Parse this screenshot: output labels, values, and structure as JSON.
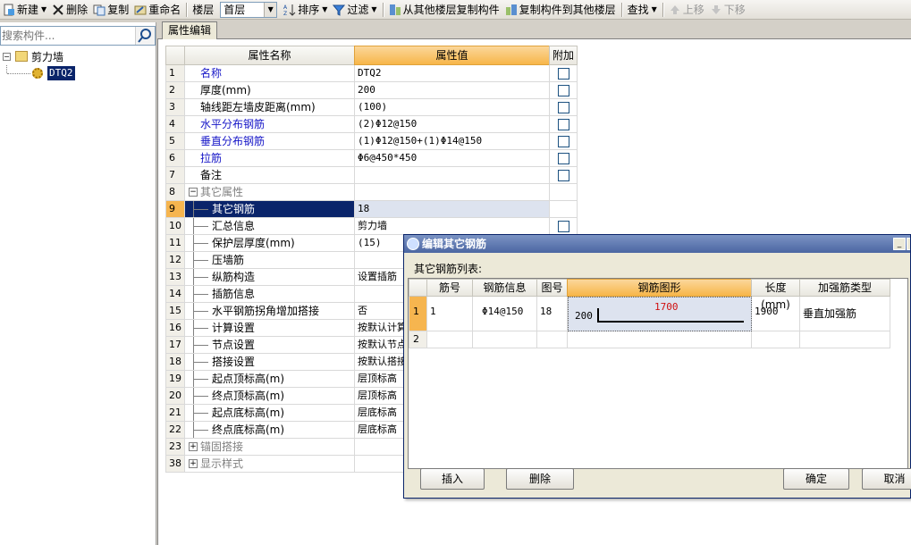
{
  "toolbar": {
    "new_label": "新建",
    "delete_label": "删除",
    "copy_label": "复制",
    "rename_label": "重命名",
    "floor_label": "楼层",
    "floor_value": "首层",
    "sort_label": "排序",
    "filter_label": "过滤",
    "copy_from_label": "从其他楼层复制构件",
    "copy_to_label": "复制构件到其他楼层",
    "find_label": "查找",
    "up_label": "上移",
    "down_label": "下移"
  },
  "search": {
    "placeholder": "搜索构件..."
  },
  "tree": {
    "root_label": "剪力墙",
    "child_label": "DTQ2"
  },
  "tab_label": "属性编辑",
  "grid": {
    "headers": {
      "name": "属性名称",
      "value": "属性值",
      "extra": "附加"
    },
    "rows": [
      {
        "num": "1",
        "name": "名称",
        "value": "DTQ2"
      },
      {
        "num": "2",
        "name": "厚度(mm)",
        "value": "200"
      },
      {
        "num": "3",
        "name": "轴线距左墙皮距离(mm)",
        "value": "(100)"
      },
      {
        "num": "4",
        "name": "水平分布钢筋",
        "value": "(2)Φ12@150"
      },
      {
        "num": "5",
        "name": "垂直分布钢筋",
        "value": "(1)Φ12@150+(1)Φ14@150"
      },
      {
        "num": "6",
        "name": "拉筋",
        "value": "Φ6@450*450"
      },
      {
        "num": "7",
        "name": "备注",
        "value": ""
      },
      {
        "num": "8",
        "name": "其它属性",
        "value": ""
      },
      {
        "num": "9",
        "name": "其它钢筋",
        "value": "18"
      },
      {
        "num": "10",
        "name": "汇总信息",
        "value": "剪力墙"
      },
      {
        "num": "11",
        "name": "保护层厚度(mm)",
        "value": "(15)"
      },
      {
        "num": "12",
        "name": "压墙筋",
        "value": ""
      },
      {
        "num": "13",
        "name": "纵筋构造",
        "value": "设置插筋"
      },
      {
        "num": "14",
        "name": "插筋信息",
        "value": ""
      },
      {
        "num": "15",
        "name": "水平钢筋拐角增加搭接",
        "value": "否"
      },
      {
        "num": "16",
        "name": "计算设置",
        "value": "按默认计算"
      },
      {
        "num": "17",
        "name": "节点设置",
        "value": "按默认节点"
      },
      {
        "num": "18",
        "name": "搭接设置",
        "value": "按默认搭接"
      },
      {
        "num": "19",
        "name": "起点顶标高(m)",
        "value": "层顶标高"
      },
      {
        "num": "20",
        "name": "终点顶标高(m)",
        "value": "层顶标高"
      },
      {
        "num": "21",
        "name": "起点底标高(m)",
        "value": "层底标高"
      },
      {
        "num": "22",
        "name": "终点底标高(m)",
        "value": "层底标高"
      },
      {
        "num": "23",
        "name": "锚固搭接",
        "value": ""
      },
      {
        "num": "38",
        "name": "显示样式",
        "value": ""
      }
    ]
  },
  "dialog": {
    "title": "编辑其它钢筋",
    "list_label": "其它钢筋列表:",
    "headers": [
      "筋号",
      "钢筋信息",
      "图号",
      "钢筋图形",
      "长度(mm)",
      "加强筋类型"
    ],
    "rows": [
      {
        "num": "1",
        "bar_no": "1",
        "info": "Φ14@150",
        "shape_no": "18",
        "shape_left": "200",
        "shape_main": "1700",
        "length": "1900",
        "type": "垂直加强筋"
      },
      {
        "num": "2",
        "bar_no": "",
        "info": "",
        "shape_no": "",
        "shape_left": "",
        "shape_main": "",
        "length": "",
        "type": ""
      }
    ],
    "buttons": {
      "insert": "插入",
      "delete": "删除",
      "ok": "确定",
      "cancel": "取消"
    }
  },
  "colors": {
    "selected": "#0a246a",
    "value_header": "#f7b649",
    "blue_text": "#1515c7",
    "shape_red": "#d01010"
  }
}
